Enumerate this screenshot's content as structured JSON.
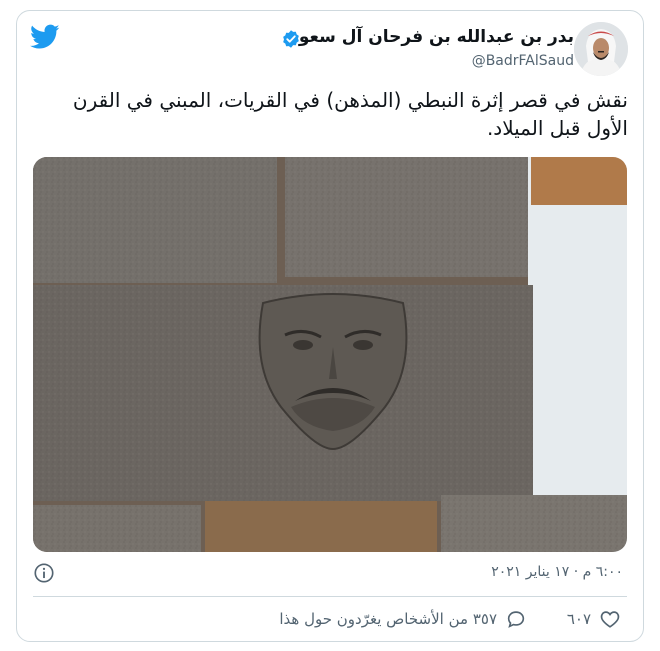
{
  "author": {
    "name": "بدر بن عبدالله بن فرحان آل سعود",
    "handle": "@BadrFAlSaud",
    "verified": true
  },
  "tweet": {
    "text": "نقش في قصر إثرة النبطي (المذهن) في القريات، المبني في القرن الأول قبل الميلاد."
  },
  "meta": {
    "timestamp": "٦:٠٠ م · ١٧ يناير ٢٠٢١"
  },
  "actions": {
    "like_count": "٦٠٧",
    "reply_text": "٣٥٧ من الأشخاص يغرّدون حول هذا"
  },
  "colors": {
    "twitter_blue": "#1d9bf0",
    "text_primary": "#0f1419",
    "text_secondary": "#536471",
    "border": "#cfd9de"
  },
  "icons": [
    "twitter-logo-icon",
    "verified-badge-icon",
    "info-icon",
    "heart-icon",
    "reply-bubble-icon"
  ]
}
